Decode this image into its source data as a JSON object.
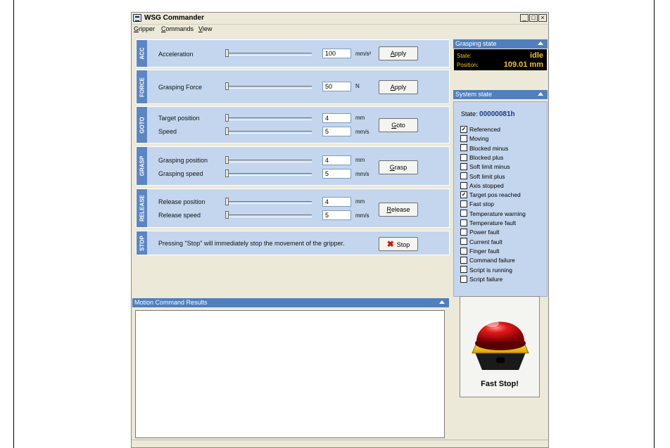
{
  "window": {
    "title": "WSG Commander",
    "min": "_",
    "max": "□",
    "close": "×"
  },
  "menu": [
    {
      "label": "Gripper",
      "accel": "G",
      "rest": "ripper"
    },
    {
      "label": "Commands",
      "accel": "C",
      "rest": "ommands"
    },
    {
      "label": "View",
      "accel": "V",
      "rest": "iew"
    }
  ],
  "acc": {
    "tab": "ACC",
    "label": "Acceleration",
    "value": "100",
    "unit": "mm/s²",
    "button_accel": "A",
    "button_rest": "pply"
  },
  "force": {
    "tab": "FORCE",
    "label": "Grasping Force",
    "value": "50",
    "unit": "N",
    "button_accel": "A",
    "button_rest": "pply"
  },
  "goto": {
    "tab": "GOTO",
    "pos_label": "Target position",
    "pos_value": "4",
    "pos_unit": "mm",
    "speed_label": "Speed",
    "speed_value": "5",
    "speed_unit": "mm/s",
    "button_accel": "G",
    "button_rest": "oto"
  },
  "grasp": {
    "tab": "GRASP",
    "pos_label": "Grasping position",
    "pos_value": "4",
    "pos_unit": "mm",
    "speed_label": "Grasping speed",
    "speed_value": "5",
    "speed_unit": "mm/s",
    "button_accel": "G",
    "button_rest": "rasp"
  },
  "release": {
    "tab": "RELEASE",
    "pos_label": "Release position",
    "pos_value": "4",
    "pos_unit": "mm",
    "speed_label": "Release speed",
    "speed_value": "5",
    "speed_unit": "mm/s",
    "button_accel": "R",
    "button_rest": "elease"
  },
  "stop": {
    "tab": "STOP",
    "message": "Pressing \"Stop\" will immediately stop the movement of the gripper.",
    "button": "Stop",
    "icon": "x-stop-icon"
  },
  "grasping_state": {
    "title": "Grasping state",
    "state_label": "State:",
    "state_value": "idle",
    "position_label": "Position:",
    "position_value": "109.01 mm"
  },
  "system_state": {
    "title": "System state",
    "state_label": "State:",
    "state_value": "00000081h",
    "flags": [
      {
        "label": "Referenced",
        "checked": true
      },
      {
        "label": "Moving",
        "checked": false
      },
      {
        "label": "Blocked minus",
        "checked": false
      },
      {
        "label": "Blocked plus",
        "checked": false
      },
      {
        "label": "Soft limit minus",
        "checked": false
      },
      {
        "label": "Soft limit plus",
        "checked": false
      },
      {
        "label": "Axis stopped",
        "checked": false
      },
      {
        "label": "Target pos reached",
        "checked": true
      },
      {
        "label": "Fast stop",
        "checked": false
      },
      {
        "label": "Temperature warning",
        "checked": false
      },
      {
        "label": "Temperature fault",
        "checked": false
      },
      {
        "label": "Power fault",
        "checked": false
      },
      {
        "label": "Current fault",
        "checked": false
      },
      {
        "label": "Finger fault",
        "checked": false
      },
      {
        "label": "Command failure",
        "checked": false
      },
      {
        "label": "Script is running",
        "checked": false
      },
      {
        "label": "Script failure",
        "checked": false
      }
    ]
  },
  "results": {
    "title": "Motion Command Results"
  },
  "fast_stop": {
    "label": "Fast Stop!"
  },
  "colors": {
    "panel_blue": "#4f7fbd",
    "section_bg": "#c3d6ee",
    "lcd_text": "#f0c419",
    "stop_red": "#d01010"
  }
}
